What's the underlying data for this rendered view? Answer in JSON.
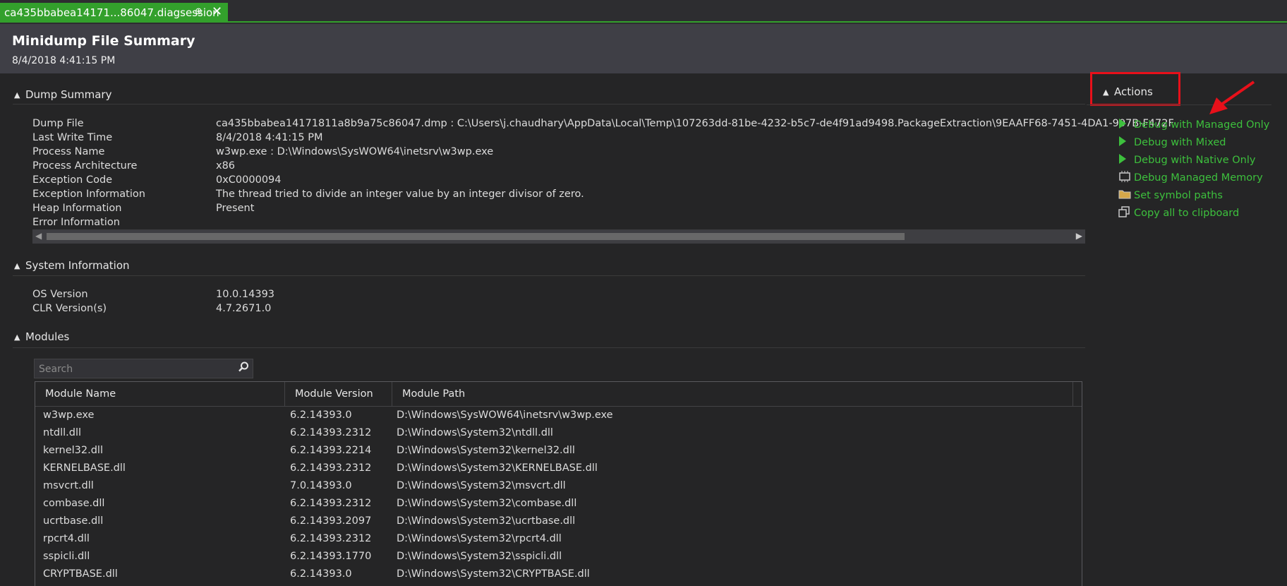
{
  "tab": {
    "title": "ca435bbabea14171...86047.diagsession",
    "pin": "⊕",
    "close": "✕"
  },
  "header": {
    "title": "Minidump File Summary",
    "date": "8/4/2018 4:41:15 PM"
  },
  "dump_summary": {
    "label": "Dump Summary",
    "rows": [
      {
        "key": "Dump File",
        "value": "ca435bbabea14171811a8b9a75c86047.dmp : C:\\Users\\j.chaudhary\\AppData\\Local\\Temp\\107263dd-81be-4232-b5c7-de4f91ad9498.PackageExtraction\\9EAAFF68-7451-4DA1-907B-F472F"
      },
      {
        "key": "Last Write Time",
        "value": "8/4/2018 4:41:15 PM"
      },
      {
        "key": "Process Name",
        "value": "w3wp.exe : D:\\Windows\\SysWOW64\\inetsrv\\w3wp.exe"
      },
      {
        "key": "Process Architecture",
        "value": "x86"
      },
      {
        "key": "Exception Code",
        "value": "0xC0000094"
      },
      {
        "key": "Exception Information",
        "value": "The thread tried to divide an integer value by an integer divisor of zero."
      },
      {
        "key": "Heap Information",
        "value": "Present"
      },
      {
        "key": "Error Information",
        "value": ""
      }
    ]
  },
  "system_information": {
    "label": "System Information",
    "rows": [
      {
        "key": "OS Version",
        "value": "10.0.14393"
      },
      {
        "key": "CLR Version(s)",
        "value": "4.7.2671.0"
      }
    ]
  },
  "modules": {
    "label": "Modules",
    "search_placeholder": "Search",
    "columns": [
      "Module Name",
      "Module Version",
      "Module Path"
    ],
    "rows": [
      [
        "w3wp.exe",
        "6.2.14393.0",
        "D:\\Windows\\SysWOW64\\inetsrv\\w3wp.exe"
      ],
      [
        "ntdll.dll",
        "6.2.14393.2312",
        "D:\\Windows\\System32\\ntdll.dll"
      ],
      [
        "kernel32.dll",
        "6.2.14393.2214",
        "D:\\Windows\\System32\\kernel32.dll"
      ],
      [
        "KERNELBASE.dll",
        "6.2.14393.2312",
        "D:\\Windows\\System32\\KERNELBASE.dll"
      ],
      [
        "msvcrt.dll",
        "7.0.14393.0",
        "D:\\Windows\\System32\\msvcrt.dll"
      ],
      [
        "combase.dll",
        "6.2.14393.2312",
        "D:\\Windows\\System32\\combase.dll"
      ],
      [
        "ucrtbase.dll",
        "6.2.14393.2097",
        "D:\\Windows\\System32\\ucrtbase.dll"
      ],
      [
        "rpcrt4.dll",
        "6.2.14393.2312",
        "D:\\Windows\\System32\\rpcrt4.dll"
      ],
      [
        "sspicli.dll",
        "6.2.14393.1770",
        "D:\\Windows\\System32\\sspicli.dll"
      ],
      [
        "CRYPTBASE.dll",
        "6.2.14393.0",
        "D:\\Windows\\System32\\CRYPTBASE.dll"
      ]
    ]
  },
  "actions": {
    "label": "Actions",
    "items": [
      {
        "label": "Debug with Managed Only",
        "icon": "play-icon"
      },
      {
        "label": "Debug with Mixed",
        "icon": "play-icon"
      },
      {
        "label": "Debug with Native Only",
        "icon": "play-icon"
      },
      {
        "label": "Debug Managed Memory",
        "icon": "memory-icon"
      },
      {
        "label": "Set symbol paths",
        "icon": "folder-icon"
      },
      {
        "label": "Copy all to clipboard",
        "icon": "copy-icon"
      }
    ]
  },
  "colors": {
    "accent": "#33a02c",
    "action_link": "#3dc03d",
    "highlight": "#e8101a",
    "background": "#252526"
  }
}
